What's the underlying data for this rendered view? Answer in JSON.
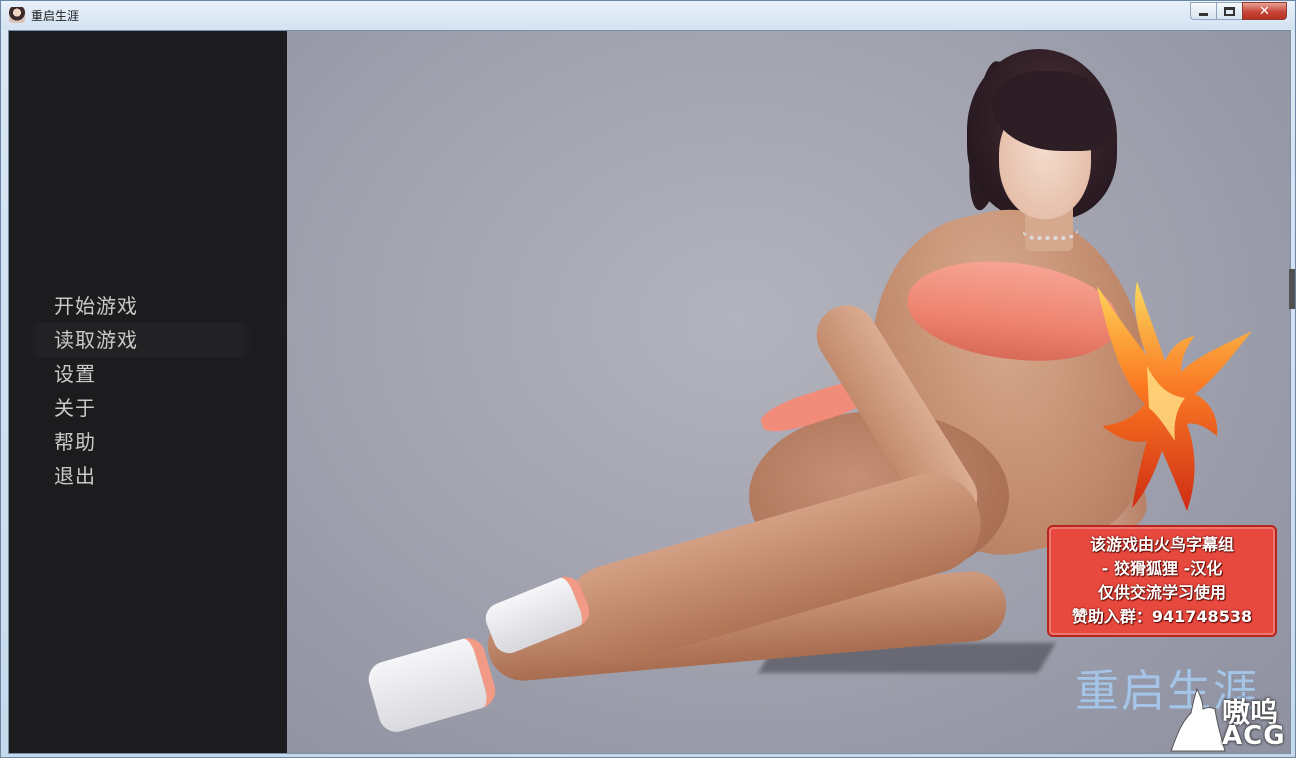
{
  "window": {
    "title": "重启生涯",
    "minimize_label": "",
    "maximize_label": "",
    "close_label": "✕"
  },
  "menu": {
    "items": [
      {
        "label": "开始游戏"
      },
      {
        "label": "读取游戏"
      },
      {
        "label": "设置"
      },
      {
        "label": "关于"
      },
      {
        "label": "帮助"
      },
      {
        "label": "退出"
      }
    ],
    "hovered_index": 1
  },
  "badge": {
    "lines": [
      "该游戏由火鸟字幕组",
      "- 狡猾狐狸 -汉化",
      "仅供交流学习使用",
      "赞助入群：941748538"
    ]
  },
  "game_logo": "重启生涯",
  "watermark": {
    "line1": "嗷呜",
    "line2": "ACG"
  },
  "colors": {
    "sidebar_bg": "#1c1c1e",
    "menu_text": "#c9c9c9",
    "badge_bg": "#e8493f",
    "logo_text": "#a6c4e6"
  },
  "icons": {
    "app_icon": "character-portrait-icon",
    "emblem": "phoenix-icon",
    "watermark_icon": "wolf-head-icon"
  }
}
